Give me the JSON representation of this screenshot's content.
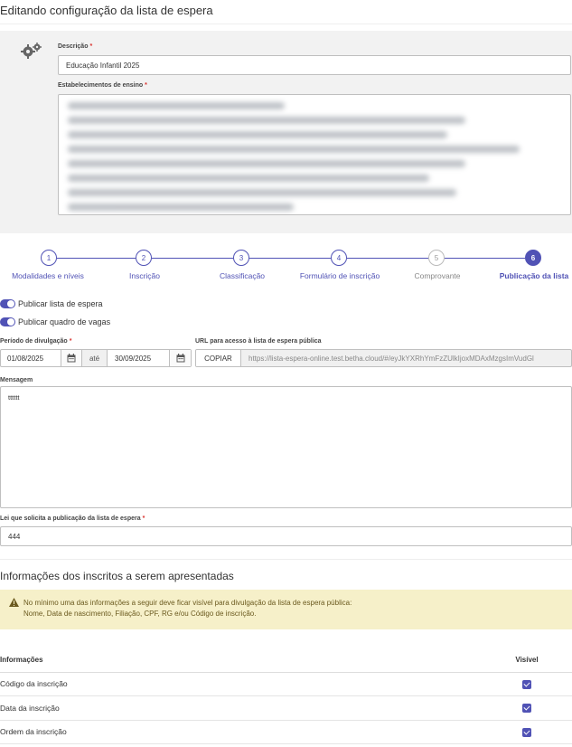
{
  "header": {
    "title": "Editando configuração da lista de espera"
  },
  "form": {
    "descricao_label": "Descrição",
    "descricao_value": "Educação Infantil 2025",
    "estabelecimentos_label": "Estabelecimentos de ensino"
  },
  "stepper": {
    "steps": [
      {
        "number": "1",
        "label": "Modalidades e níveis"
      },
      {
        "number": "2",
        "label": "Inscrição"
      },
      {
        "number": "3",
        "label": "Classificação"
      },
      {
        "number": "4",
        "label": "Formulário de inscrição"
      },
      {
        "number": "5",
        "label": "Comprovante"
      },
      {
        "number": "6",
        "label": "Publicação da lista"
      }
    ],
    "active_step": 6
  },
  "publish": {
    "toggle_lista": "Publicar lista de espera",
    "toggle_quadro": "Publicar quadro de vagas",
    "periodo_label": "Período de divulgação",
    "data_inicio": "01/08/2025",
    "ate": "até",
    "data_fim": "30/09/2025",
    "url_label": "URL para acesso à lista de espera pública",
    "copy_button": "COPIAR",
    "url_value": "https://lista-espera-online.test.betha.cloud/#/eyJkYXRhYmFzZUlkIjoxMDAxMzgsImVudGl",
    "mensagem_label": "Mensagem",
    "mensagem_value": "tttttt",
    "lei_label": "Lei que solicita a publicação da lista de espera",
    "lei_value": "444"
  },
  "info_section": {
    "title": "Informações dos inscritos a serem apresentadas",
    "warning_line1": "No mínimo uma das informações a seguir deve ficar visível para divulgação da lista de espera pública:",
    "warning_line2": "Nome, Data de nascimento, Filiação, CPF, RG e/ou Código de inscrição.",
    "col_info": "Informações",
    "col_visivel": "Visível",
    "rows": [
      {
        "label": "Código da inscrição",
        "visible": true
      },
      {
        "label": "Data da inscrição",
        "visible": true
      },
      {
        "label": "Ordem da inscrição",
        "visible": true
      }
    ]
  },
  "colors": {
    "accent": "#5052b5",
    "required": "#d9302c",
    "warning_bg": "#f6f0c9"
  },
  "icons": [
    "gears-icon",
    "calendar-icon",
    "warning-icon",
    "checkbox-checked-icon"
  ]
}
